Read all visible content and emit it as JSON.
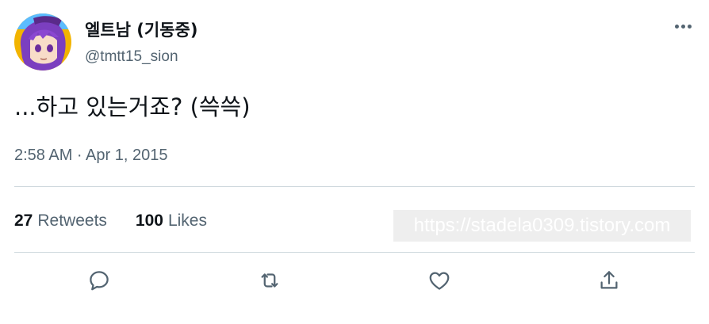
{
  "user": {
    "display_name": "엘트남 (기동중)",
    "handle": "@tmtt15_sion",
    "avatar_icon": "avatar-anime-character"
  },
  "tweet": {
    "text": "...하고 있는거죠? (쓱쓱)",
    "timestamp": "2:58 AM · Apr 1, 2015"
  },
  "stats": {
    "retweets_count": "27",
    "retweets_label": "Retweets",
    "likes_count": "100",
    "likes_label": "Likes"
  },
  "watermark": {
    "text": "https://stadela0309.tistory.com"
  },
  "actions": {
    "reply_icon": "reply-icon",
    "retweet_icon": "retweet-icon",
    "like_icon": "heart-icon",
    "share_icon": "share-icon"
  },
  "colors": {
    "text_primary": "#0f1419",
    "text_secondary": "#536471",
    "divider": "#cfd9de"
  }
}
